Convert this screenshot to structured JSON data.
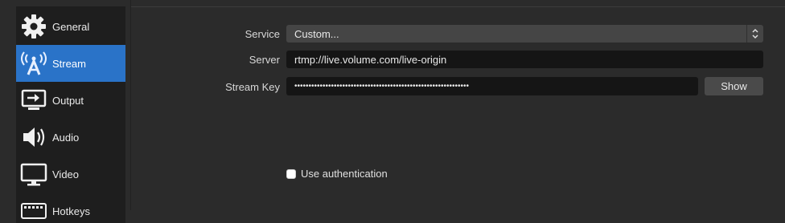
{
  "sidebar": {
    "items": [
      {
        "label": "General",
        "icon": "gear-icon",
        "active": false
      },
      {
        "label": "Stream",
        "icon": "broadcast-antenna-icon",
        "active": true
      },
      {
        "label": "Output",
        "icon": "output-icon",
        "active": false
      },
      {
        "label": "Audio",
        "icon": "speaker-icon",
        "active": false
      },
      {
        "label": "Video",
        "icon": "monitor-icon",
        "active": false
      },
      {
        "label": "Hotkeys",
        "icon": "keyboard-icon",
        "active": false
      }
    ]
  },
  "stream": {
    "service_label": "Service",
    "service_value": "Custom...",
    "server_label": "Server",
    "server_value": "rtmp://live.volume.com/live-origin",
    "key_label": "Stream Key",
    "key_value": "••••••••••••••••••••••••••••••••••••••••••••••••••••••••••••••",
    "show_button": "Show",
    "auth_label": "Use authentication",
    "auth_checked": false
  },
  "colors": {
    "accent": "#2a73c8",
    "background": "#2b2b2b",
    "sidebar": "#1e1e1e",
    "input": "#151515"
  }
}
